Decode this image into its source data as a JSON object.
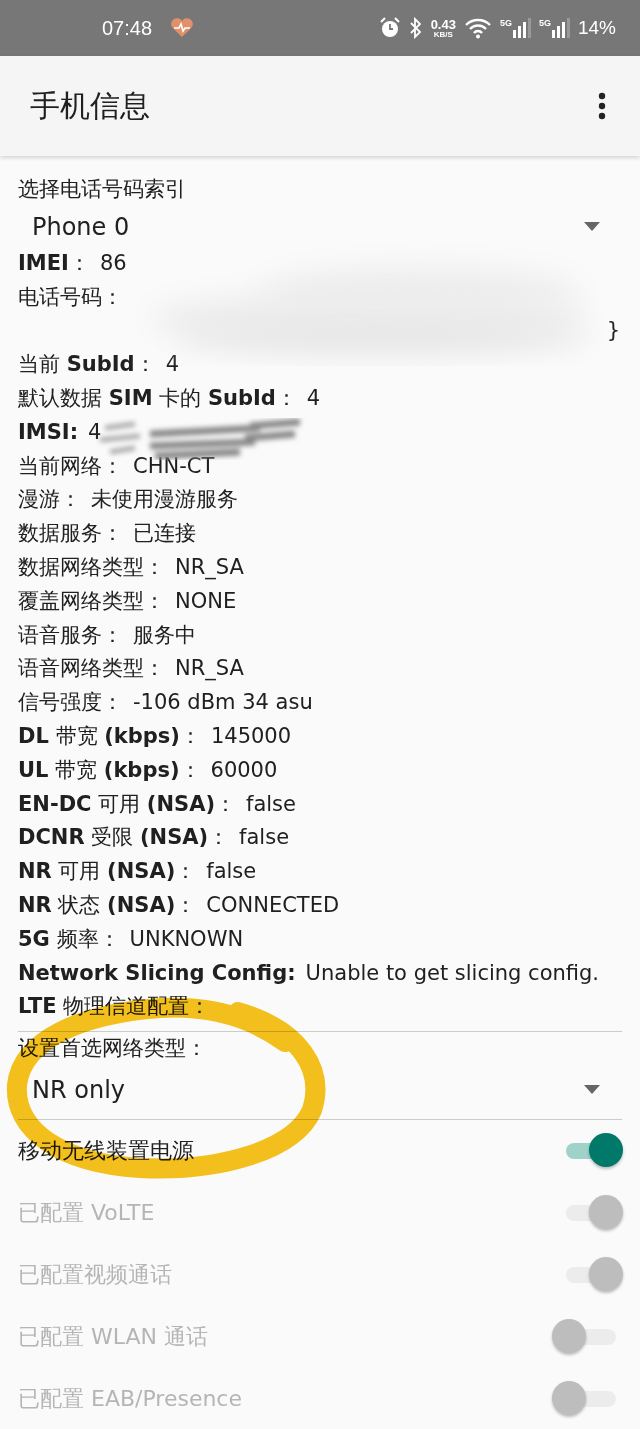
{
  "status_bar": {
    "time": "07:48",
    "speed_value": "0.43",
    "speed_unit": "KB/S",
    "sim_labels": [
      "5G",
      "5G"
    ],
    "battery": "14%"
  },
  "app_bar": {
    "title": "手机信息"
  },
  "phone_index": {
    "label": "选择电话号码索引",
    "value": "Phone 0"
  },
  "info_rows": [
    {
      "label": "**IMEI**：",
      "value": "86"
    },
    {
      "label": "电话号码：",
      "value": "",
      "tail": "}"
    },
    {
      "label": "当前 **SubId**：",
      "value": "4"
    },
    {
      "label": "默认数据 **SIM** 卡的 **SubId**：",
      "value": "4"
    },
    {
      "label": "**IMSI:**",
      "value": "4"
    },
    {
      "label": "当前网络：",
      "value": "CHN-CT"
    },
    {
      "label": "漫游：",
      "value": "未使用漫游服务"
    },
    {
      "label": "数据服务：",
      "value": "已连接"
    },
    {
      "label": "数据网络类型：",
      "value": "NR_SA"
    },
    {
      "label": "覆盖网络类型：",
      "value": "NONE"
    },
    {
      "label": "语音服务：",
      "value": "服务中"
    },
    {
      "label": "语音网络类型：",
      "value": "NR_SA"
    },
    {
      "label": "信号强度：",
      "value": "-106 dBm   34 asu"
    },
    {
      "label": "**DL** 带宽 **(kbps)**：",
      "value": "145000"
    },
    {
      "label": "**UL** 带宽 **(kbps)**：",
      "value": "60000"
    },
    {
      "label": "**EN-DC** 可用 **(NSA)**：",
      "value": "false"
    },
    {
      "label": "**DCNR** 受限 **(NSA)**：",
      "value": "false"
    },
    {
      "label": "**NR** 可用 **(NSA)**：",
      "value": "false"
    },
    {
      "label": "**NR** 状态 **(NSA)**：",
      "value": "CONNECTED"
    },
    {
      "label": "**5G** 频率：",
      "value": "UNKNOWN"
    },
    {
      "label": "**Network Slicing Config:**",
      "value": "Unable to get slicing config."
    },
    {
      "label": "**LTE** 物理信道配置：",
      "value": ""
    }
  ],
  "preferred_network": {
    "label": "设置首选网络类型：",
    "value": "NR only"
  },
  "switches": [
    {
      "label": "移动无线装置电源",
      "checked": true,
      "disabled": false
    },
    {
      "label": "已配置 VoLTE",
      "checked": true,
      "disabled": true
    },
    {
      "label": "已配置视频通话",
      "checked": true,
      "disabled": true
    },
    {
      "label": "已配置 WLAN 通话",
      "checked": false,
      "disabled": true
    },
    {
      "label": "已配置 EAB/Presence",
      "checked": false,
      "disabled": true
    }
  ],
  "annotation": {
    "kind": "circle"
  }
}
